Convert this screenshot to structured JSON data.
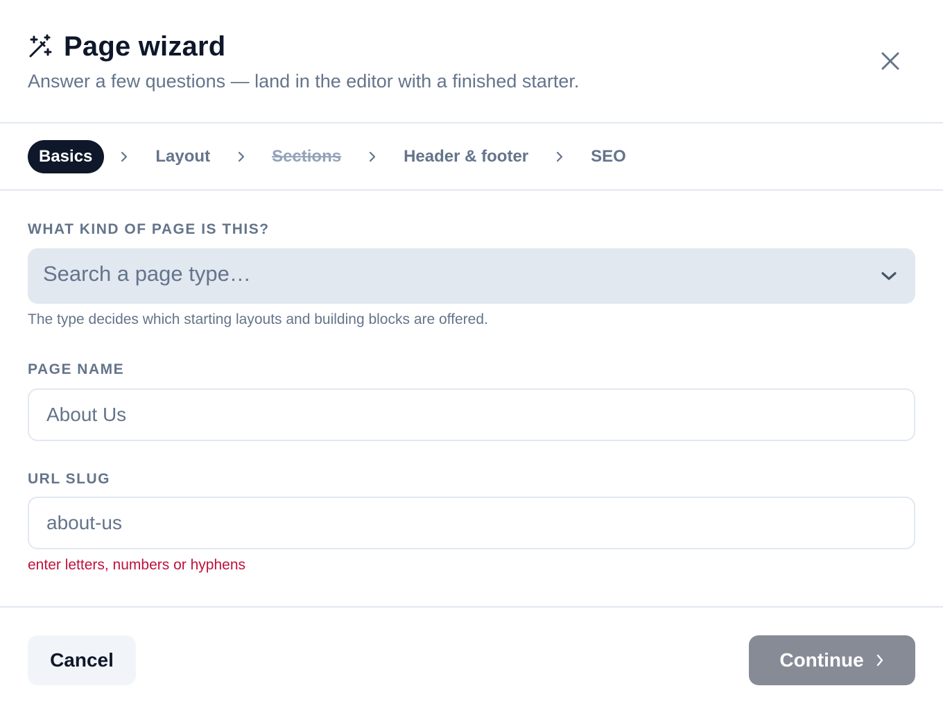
{
  "dialog": {
    "title": "Page wizard",
    "title_icon": "magic-wand-icon",
    "subtitle": "Answer a few questions — land in the editor with a finished starter.",
    "close_icon": "close-icon"
  },
  "steps": [
    {
      "label": "Basics",
      "state": "active"
    },
    {
      "label": "Layout",
      "state": "default"
    },
    {
      "label": "Sections",
      "state": "struck"
    },
    {
      "label": "Header & footer",
      "state": "default"
    },
    {
      "label": "SEO",
      "state": "default"
    }
  ],
  "form": {
    "page_type": {
      "label": "WHAT KIND OF PAGE IS THIS?",
      "placeholder": "Search a page type…",
      "help": "The type decides which starting layouts and building blocks are offered."
    },
    "page_name": {
      "label": "PAGE NAME",
      "value": "About Us"
    },
    "url_slug": {
      "label": "URL SLUG",
      "value": "about-us",
      "error": "enter letters, numbers or hyphens"
    }
  },
  "footer": {
    "cancel_label": "Cancel",
    "continue_label": "Continue"
  },
  "colors": {
    "accent": "#0f172a",
    "muted": "#64748b",
    "error": "#be123c",
    "continue_disabled": "#868b96"
  }
}
